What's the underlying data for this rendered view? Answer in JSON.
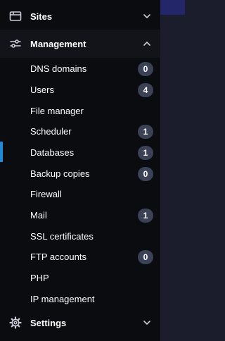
{
  "sections": {
    "sites": {
      "label": "Sites",
      "icon": "window-icon",
      "expanded": false
    },
    "management": {
      "label": "Management",
      "icon": "sliders-icon",
      "expanded": true
    },
    "settings": {
      "label": "Settings",
      "icon": "gear-icon",
      "expanded": false
    }
  },
  "management_items": [
    {
      "label": "DNS domains",
      "badge": "0"
    },
    {
      "label": "Users",
      "badge": "4"
    },
    {
      "label": "File manager",
      "badge": ""
    },
    {
      "label": "Scheduler",
      "badge": "1"
    },
    {
      "label": "Databases",
      "badge": "1",
      "active": true
    },
    {
      "label": "Backup copies",
      "badge": "0"
    },
    {
      "label": "Firewall",
      "badge": ""
    },
    {
      "label": "Mail",
      "badge": "1"
    },
    {
      "label": "SSL certificates",
      "badge": ""
    },
    {
      "label": "FTP accounts",
      "badge": "0"
    },
    {
      "label": "PHP",
      "badge": ""
    },
    {
      "label": "IP management",
      "badge": ""
    }
  ],
  "colors": {
    "sidebar_bg": "#0b0c10",
    "badge_bg": "#3b4256",
    "active_indicator": "#1f8bd8",
    "content_bg": "#1b1d2c"
  }
}
